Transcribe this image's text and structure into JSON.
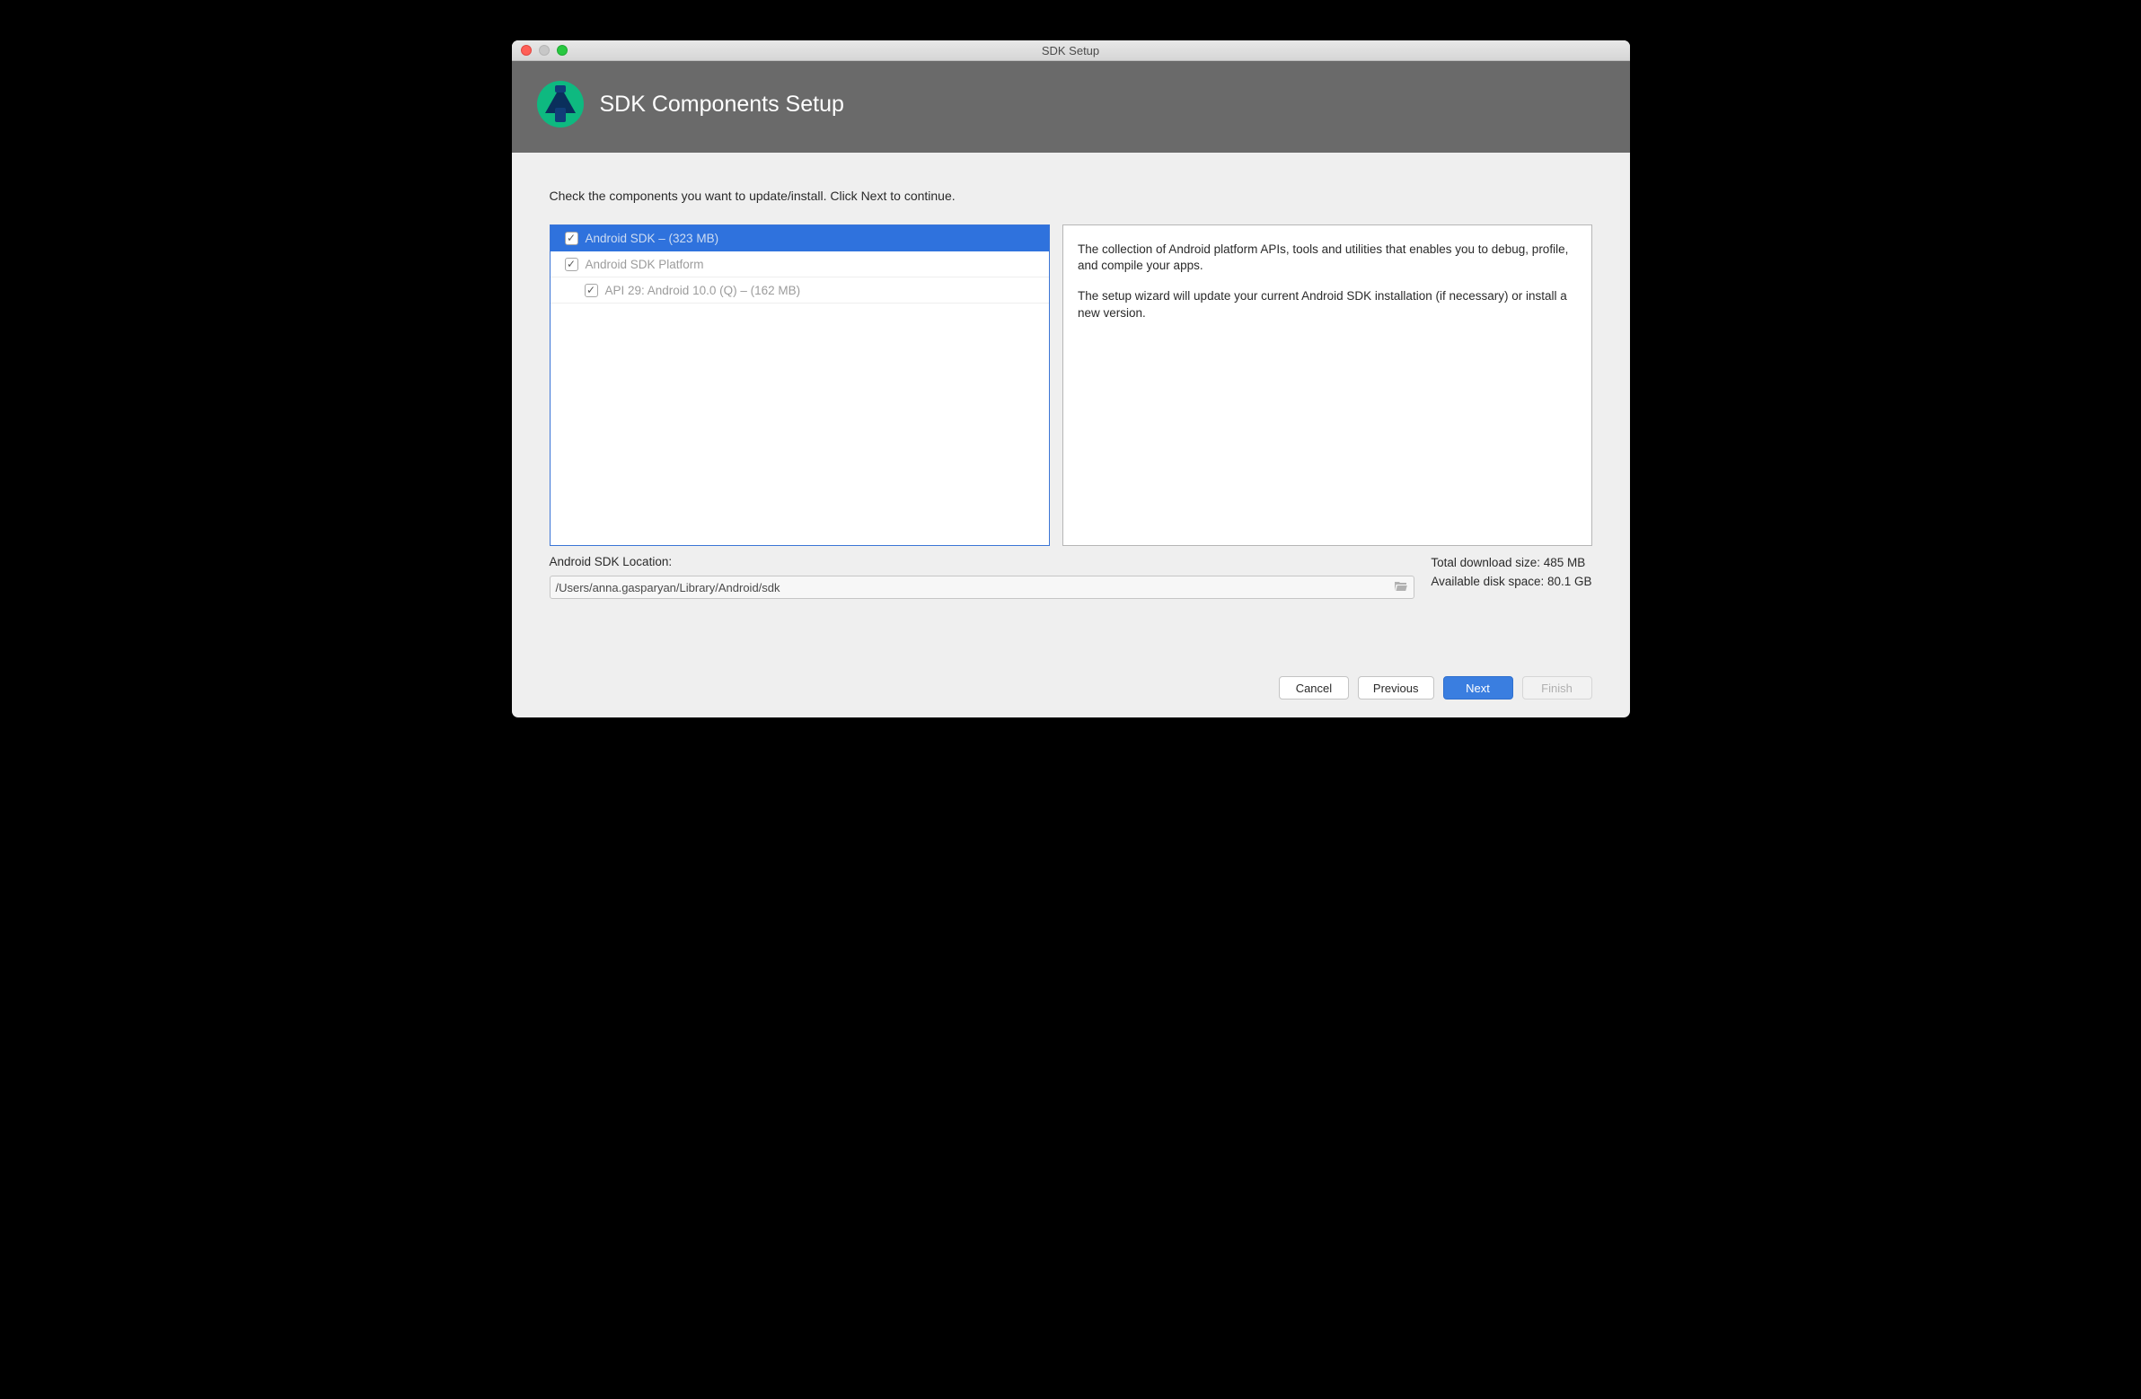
{
  "window": {
    "title": "SDK Setup"
  },
  "header": {
    "page_title": "SDK Components Setup"
  },
  "instruction": "Check the components you want to update/install. Click Next to continue.",
  "components": [
    {
      "label": "Android SDK – (323 MB)",
      "checked": true,
      "indent": 0,
      "selected": true,
      "dim": false
    },
    {
      "label": "Android SDK Platform",
      "checked": true,
      "indent": 0,
      "selected": false,
      "dim": true
    },
    {
      "label": "API 29: Android 10.0 (Q) – (162 MB)",
      "checked": true,
      "indent": 1,
      "selected": false,
      "dim": true
    }
  ],
  "description": {
    "p1": "The collection of Android platform APIs, tools and utilities that enables you to debug, profile, and compile your apps.",
    "p2": "The setup wizard will update your current Android SDK installation (if necessary) or install a new version."
  },
  "sdk_location": {
    "label": "Android SDK Location:",
    "path": "/Users/anna.gasparyan/Library/Android/sdk"
  },
  "stats": {
    "download": "Total download size: 485 MB",
    "disk": "Available disk space: 80.1 GB"
  },
  "buttons": {
    "cancel": "Cancel",
    "previous": "Previous",
    "next": "Next",
    "finish": "Finish"
  }
}
